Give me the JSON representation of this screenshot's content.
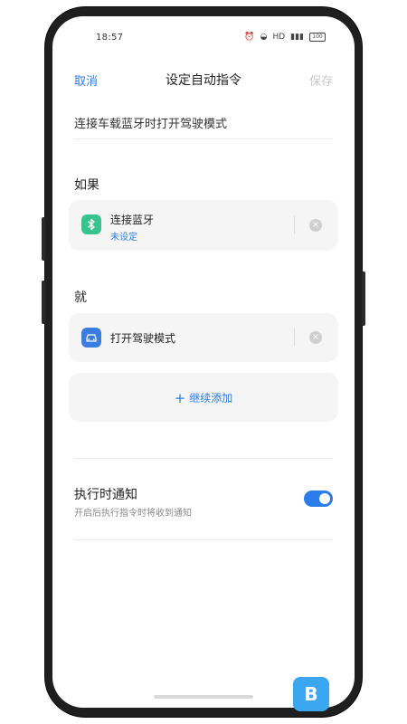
{
  "status": {
    "time": "18:57",
    "network": "HD",
    "battery": "100"
  },
  "nav": {
    "cancel": "取消",
    "title": "设定自动指令",
    "save": "保存"
  },
  "shortcut_name": "连接车载蓝牙时打开驾驶模式",
  "if_section": {
    "label": "如果",
    "trigger": {
      "title": "连接蓝牙",
      "subtitle": "未设定",
      "icon": "bluetooth-icon"
    }
  },
  "then_section": {
    "label": "就",
    "action": {
      "title": "打开驾驶模式",
      "icon": "car-icon"
    },
    "add_label": "继续添加"
  },
  "notify": {
    "title": "执行时通知",
    "subtitle": "开启后执行指令时将收到通知",
    "enabled": true
  },
  "colors": {
    "accent": "#2b7de9",
    "bluetooth": "#36c38f",
    "car": "#3a7de0"
  }
}
